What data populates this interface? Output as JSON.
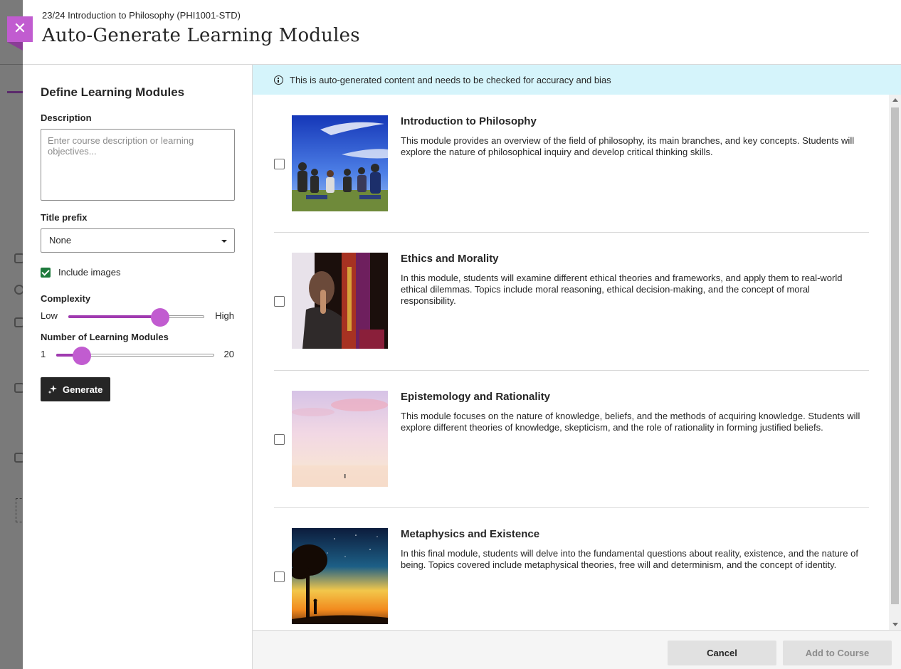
{
  "colors": {
    "accent": "#c15cd0",
    "slider_fill": "#a03ab0",
    "banner_bg": "#d5f4fb",
    "check": "#1e7a3c",
    "dark_button": "#262626"
  },
  "header": {
    "breadcrumb": "23/24 Introduction to Philosophy (PHI1001-STD)",
    "title": "Auto-Generate Learning Modules",
    "close_icon": "close-icon"
  },
  "form": {
    "section_title": "Define Learning Modules",
    "description_label": "Description",
    "description_placeholder": "Enter course description or learning objectives...",
    "description_value": "",
    "title_prefix_label": "Title prefix",
    "title_prefix_value": "None",
    "include_images_label": "Include images",
    "include_images_checked": true,
    "complexity_label": "Complexity",
    "complexity_low": "Low",
    "complexity_high": "High",
    "complexity_level": 0.67,
    "modules_count_label": "Number of Learning Modules",
    "modules_min": "1",
    "modules_max": "20",
    "modules_value": 4,
    "generate_label": "Generate",
    "generate_icon": "sparkle-icon"
  },
  "banner": {
    "icon": "info-icon",
    "text": "This is auto-generated content and needs to be checked for accuracy and bias"
  },
  "modules": [
    {
      "title": "Introduction to Philosophy",
      "description": "This module provides an overview of the field of philosophy, its main branches, and key concepts. Students will explore the nature of philosophical inquiry and develop critical thinking skills.",
      "checked": false
    },
    {
      "title": "Ethics and Morality",
      "description": "In this module, students will examine different ethical theories and frameworks, and apply them to real-world ethical dilemmas. Topics include moral reasoning, ethical decision-making, and the concept of moral responsibility.",
      "checked": false
    },
    {
      "title": "Epistemology and Rationality",
      "description": "This module focuses on the nature of knowledge, beliefs, and the methods of acquiring knowledge. Students will explore different theories of knowledge, skepticism, and the role of rationality in forming justified beliefs.",
      "checked": false
    },
    {
      "title": "Metaphysics and Existence",
      "description": "In this final module, students will delve into the fundamental questions about reality, existence, and the nature of being. Topics covered include metaphysical theories, free will and determinism, and the concept of identity.",
      "checked": false
    }
  ],
  "footer": {
    "cancel_label": "Cancel",
    "add_label": "Add to Course"
  }
}
